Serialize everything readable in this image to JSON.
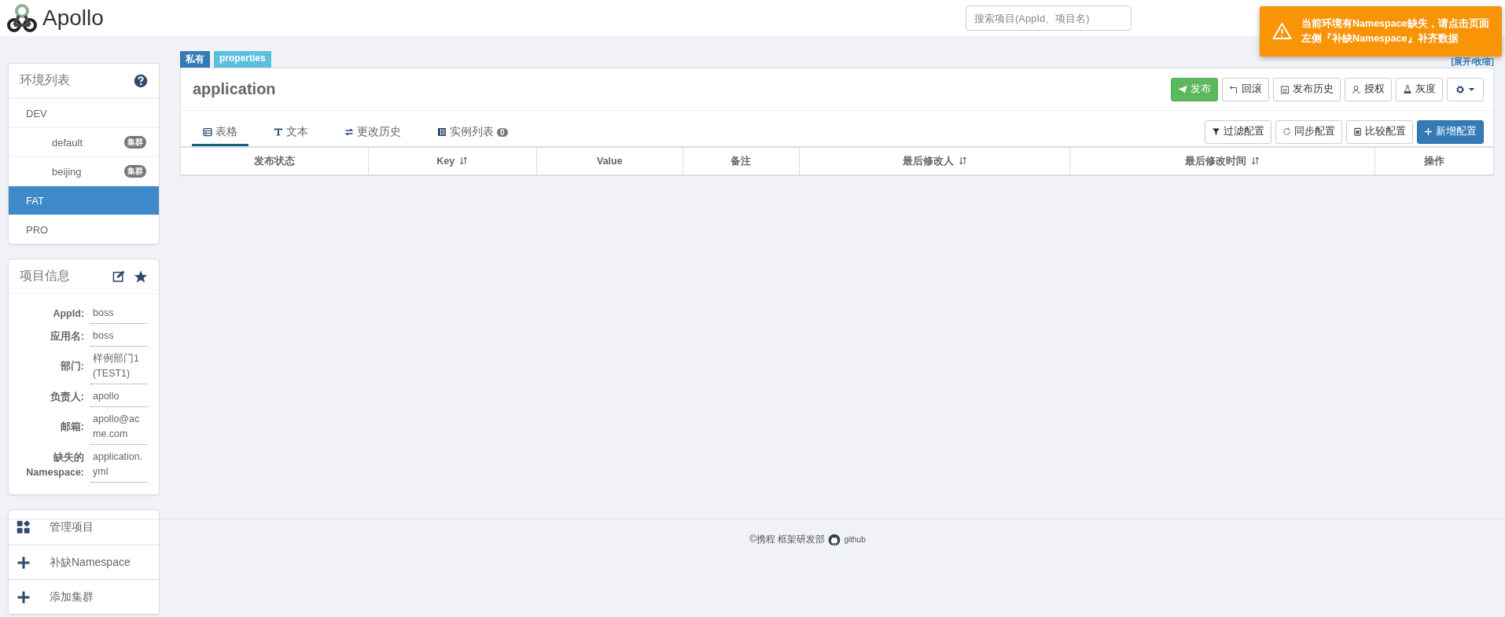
{
  "header": {
    "logo_text": "Apollo",
    "search": {
      "placeholder": "搜索项目(AppId、项目名)"
    }
  },
  "toast": {
    "message": "当前环境有Namespace缺失，请点击页面左侧『补缺Namespace』补齐数据"
  },
  "env_panel": {
    "title": "环境列表",
    "items": [
      {
        "label": "DEV",
        "selected": false,
        "children": [
          {
            "label": "default",
            "badge": "集群",
            "selected": false
          },
          {
            "label": "beijing",
            "badge": "集群",
            "selected": false
          }
        ]
      },
      {
        "label": "FAT",
        "selected": true
      },
      {
        "label": "PRO",
        "selected": false
      }
    ]
  },
  "project_panel": {
    "title": "项目信息",
    "fields": [
      {
        "label": "AppId:",
        "value": "boss"
      },
      {
        "label": "应用名:",
        "value": "boss"
      },
      {
        "label": "部门:",
        "value": "样例部门1(TEST1)"
      },
      {
        "label": "负责人:",
        "value": "apollo"
      },
      {
        "label": "邮箱:",
        "value": "apollo@acme.com"
      },
      {
        "label": "缺失的Namespace:",
        "value": "application.yml"
      }
    ]
  },
  "actions": [
    {
      "kind": "grid",
      "label": "管理项目"
    },
    {
      "kind": "plus",
      "label": "补缺Namespace"
    },
    {
      "kind": "plus",
      "label": "添加集群"
    }
  ],
  "namespace": {
    "tags": [
      {
        "kind": "private",
        "label": "私有"
      },
      {
        "kind": "format",
        "label": "properties"
      }
    ],
    "toggle": "[展开/收缩]",
    "name": "application",
    "buttons": [
      {
        "kind": "publish",
        "label": "发布"
      },
      {
        "kind": "rollback",
        "label": "回滚"
      },
      {
        "kind": "history",
        "label": "发布历史"
      },
      {
        "kind": "grant",
        "label": "授权"
      },
      {
        "kind": "gray",
        "label": "灰度"
      },
      {
        "kind": "settings"
      }
    ],
    "tabs": [
      {
        "kind": "table",
        "label": "表格",
        "selected": true
      },
      {
        "kind": "text",
        "label": "文本",
        "selected": false
      },
      {
        "kind": "history",
        "label": "更改历史",
        "selected": false
      },
      {
        "kind": "instances",
        "label": "实例列表",
        "selected": false,
        "count": "0"
      }
    ],
    "tools": [
      {
        "kind": "filter",
        "label": "过滤配置"
      },
      {
        "kind": "sync",
        "label": "同步配置"
      },
      {
        "kind": "compare",
        "label": "比较配置"
      },
      {
        "kind": "add",
        "label": "新增配置"
      }
    ],
    "table": {
      "columns": [
        {
          "label": "发布状态",
          "sortable": false
        },
        {
          "label": "Key",
          "sortable": true
        },
        {
          "label": "Value",
          "sortable": false
        },
        {
          "label": "备注",
          "sortable": false
        },
        {
          "label": "最后修改人",
          "sortable": true
        },
        {
          "label": "最后修改时间",
          "sortable": true
        },
        {
          "label": "操作",
          "sortable": false
        }
      ]
    }
  },
  "footer": {
    "copyright": "©携程 框架研发部",
    "link": "github"
  }
}
